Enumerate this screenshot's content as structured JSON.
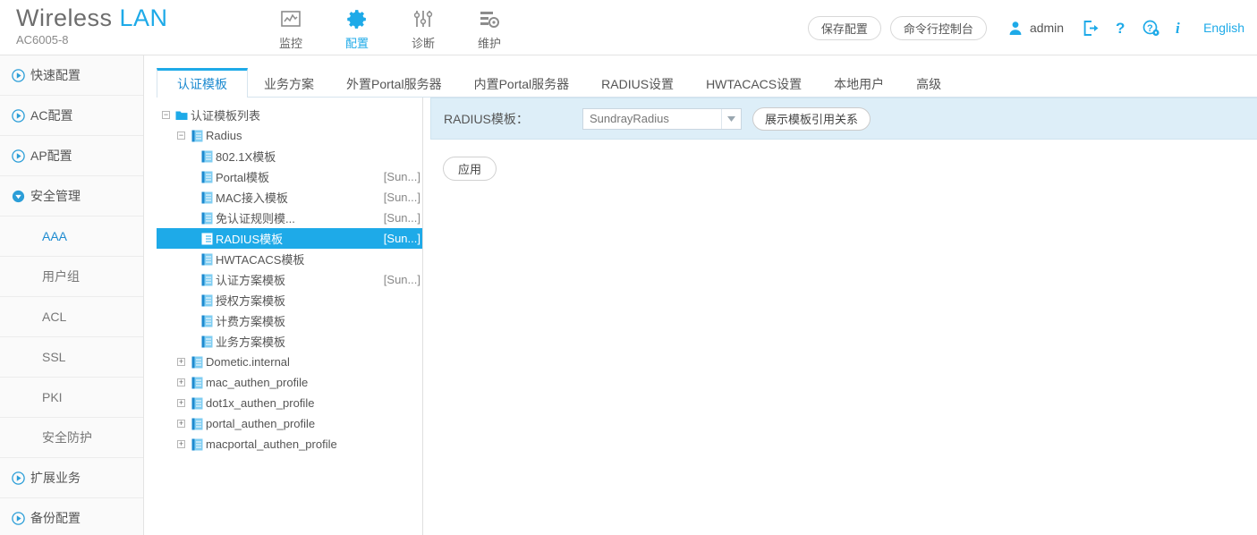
{
  "brand": {
    "name_part1": "Wireless",
    "name_part2": "LAN",
    "model": "AC6005-8"
  },
  "topnav": [
    {
      "label": "监控",
      "icon": "monitor-icon",
      "active": false
    },
    {
      "label": "配置",
      "icon": "gear-icon",
      "active": true
    },
    {
      "label": "诊断",
      "icon": "sliders-icon",
      "active": false
    },
    {
      "label": "维护",
      "icon": "maintenance-icon",
      "active": false
    }
  ],
  "topright": {
    "save_config_label": "保存配置",
    "cli_console_label": "命令行控制台",
    "user_icon": "user-icon",
    "username": "admin",
    "logout_icon": "logout-icon",
    "help_icon": "question-icon",
    "support_icon": "question-gear-icon",
    "info_icon": "info-icon",
    "language": "English"
  },
  "sidebar": [
    {
      "label": "快速配置",
      "icon": "circle-play-icon",
      "type": "group",
      "expanded": false
    },
    {
      "label": "AC配置",
      "icon": "circle-play-icon",
      "type": "group",
      "expanded": false
    },
    {
      "label": "AP配置",
      "icon": "circle-play-icon",
      "type": "group",
      "expanded": false
    },
    {
      "label": "安全管理",
      "icon": "circle-chevron-down-icon",
      "type": "group",
      "expanded": true
    },
    {
      "label": "AAA",
      "type": "sub",
      "active": true
    },
    {
      "label": "用户组",
      "type": "sub",
      "active": false
    },
    {
      "label": "ACL",
      "type": "sub",
      "active": false
    },
    {
      "label": "SSL",
      "type": "sub",
      "active": false
    },
    {
      "label": "PKI",
      "type": "sub",
      "active": false
    },
    {
      "label": "安全防护",
      "type": "sub",
      "active": false
    },
    {
      "label": "扩展业务",
      "icon": "circle-play-icon",
      "type": "group",
      "expanded": false
    },
    {
      "label": "备份配置",
      "icon": "circle-play-icon",
      "type": "group",
      "expanded": false
    }
  ],
  "tabs": [
    {
      "label": "认证模板",
      "active": true
    },
    {
      "label": "业务方案",
      "active": false
    },
    {
      "label": "外置Portal服务器",
      "active": false
    },
    {
      "label": "内置Portal服务器",
      "active": false
    },
    {
      "label": "RADIUS设置",
      "active": false
    },
    {
      "label": "HWTACACS设置",
      "active": false
    },
    {
      "label": "本地用户",
      "active": false
    },
    {
      "label": "高级",
      "active": false
    }
  ],
  "tree": [
    {
      "label": "认证模板列表",
      "suffix": "",
      "indent": 0,
      "toggle": "minus",
      "icon": "folder-icon",
      "selected": false
    },
    {
      "label": "Radius",
      "suffix": "",
      "indent": 1,
      "toggle": "minus",
      "icon": "file-icon",
      "selected": false
    },
    {
      "label": "802.1X模板",
      "suffix": "",
      "indent": 2,
      "toggle": "none",
      "icon": "file-icon",
      "selected": false
    },
    {
      "label": "Portal模板",
      "suffix": "[Sun...]",
      "indent": 2,
      "toggle": "none",
      "icon": "file-icon",
      "selected": false
    },
    {
      "label": "MAC接入模板",
      "suffix": "[Sun...]",
      "indent": 2,
      "toggle": "none",
      "icon": "file-icon",
      "selected": false
    },
    {
      "label": "免认证规则模...",
      "suffix": "[Sun...]",
      "indent": 2,
      "toggle": "none",
      "icon": "file-icon",
      "selected": false
    },
    {
      "label": "RADIUS模板",
      "suffix": "[Sun...]",
      "indent": 2,
      "toggle": "none",
      "icon": "file-icon",
      "selected": true
    },
    {
      "label": "HWTACACS模板",
      "suffix": "",
      "indent": 2,
      "toggle": "none",
      "icon": "file-icon",
      "selected": false
    },
    {
      "label": "认证方案模板",
      "suffix": "[Sun...]",
      "indent": 2,
      "toggle": "none",
      "icon": "file-icon",
      "selected": false
    },
    {
      "label": "授权方案模板",
      "suffix": "",
      "indent": 2,
      "toggle": "none",
      "icon": "file-icon",
      "selected": false
    },
    {
      "label": "计费方案模板",
      "suffix": "",
      "indent": 2,
      "toggle": "none",
      "icon": "file-icon",
      "selected": false
    },
    {
      "label": "业务方案模板",
      "suffix": "",
      "indent": 2,
      "toggle": "none",
      "icon": "file-icon",
      "selected": false
    },
    {
      "label": "Dometic.internal",
      "suffix": "",
      "indent": 1,
      "toggle": "plus",
      "icon": "file-icon",
      "selected": false
    },
    {
      "label": "mac_authen_profile",
      "suffix": "",
      "indent": 1,
      "toggle": "plus",
      "icon": "file-icon",
      "selected": false
    },
    {
      "label": "dot1x_authen_profile",
      "suffix": "",
      "indent": 1,
      "toggle": "plus",
      "icon": "file-icon",
      "selected": false
    },
    {
      "label": "portal_authen_profile",
      "suffix": "",
      "indent": 1,
      "toggle": "plus",
      "icon": "file-icon",
      "selected": false
    },
    {
      "label": "macportal_authen_profile",
      "suffix": "",
      "indent": 1,
      "toggle": "plus",
      "icon": "file-icon",
      "selected": false
    }
  ],
  "form": {
    "radius_template_label": "RADIUS模板：",
    "radius_template_value": "SundrayRadius",
    "show_reference_label": "展示模板引用关系",
    "apply_label": "应用"
  },
  "colors": {
    "accent": "#1eaae8",
    "link": "#1e8bd0",
    "panel_blue": "#ddeef8",
    "selection": "#1eaae8"
  }
}
